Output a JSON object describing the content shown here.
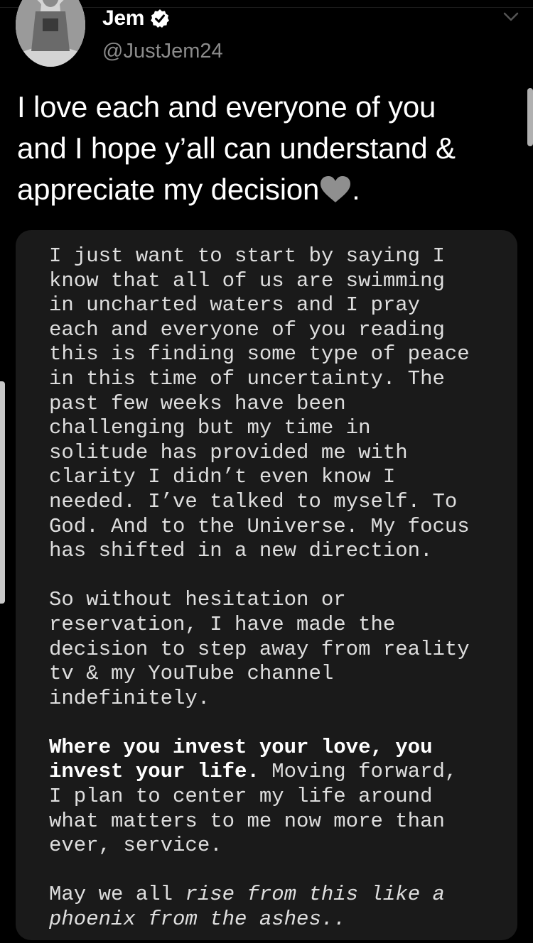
{
  "author": {
    "name": "Jem",
    "handle": "@JustJem24",
    "verified": true
  },
  "tweet": {
    "text": "I love each and everyone of you\nand I hope y’all can understand &\nappreciate my decision",
    "trailing": ".",
    "emoji": "grey-heart"
  },
  "note": {
    "p1": "I just want to start by saying I\nknow that all of us are swimming\nin uncharted waters and I pray\neach and everyone of you reading\nthis is finding some type of peace\nin this time of uncertainty. The\npast few weeks have been\nchallenging but my time in\nsolitude has provided me with\nclarity I didn’t even know I\nneeded. I’ve talked to myself. To\nGod. And to the Universe. My focus\nhas shifted in a new direction.",
    "p2": "So without hesitation or\nreservation, I have made the\ndecision to step away from reality\ntv & my YouTube channel\nindefinitely.",
    "p3_bold": "Where you invest your love, you\ninvest your life.",
    "p3_rest": " Moving forward,\nI plan to center my life around\nwhat matters to me now more than\never, service.",
    "p4_a": "May we all ",
    "p4_italic": "rise from this like a\nphoenix from the ashes..",
    "p4_rest": ""
  },
  "colors": {
    "background": "#000000",
    "card": "#1a1a1a",
    "handle": "#8b8b8b"
  }
}
